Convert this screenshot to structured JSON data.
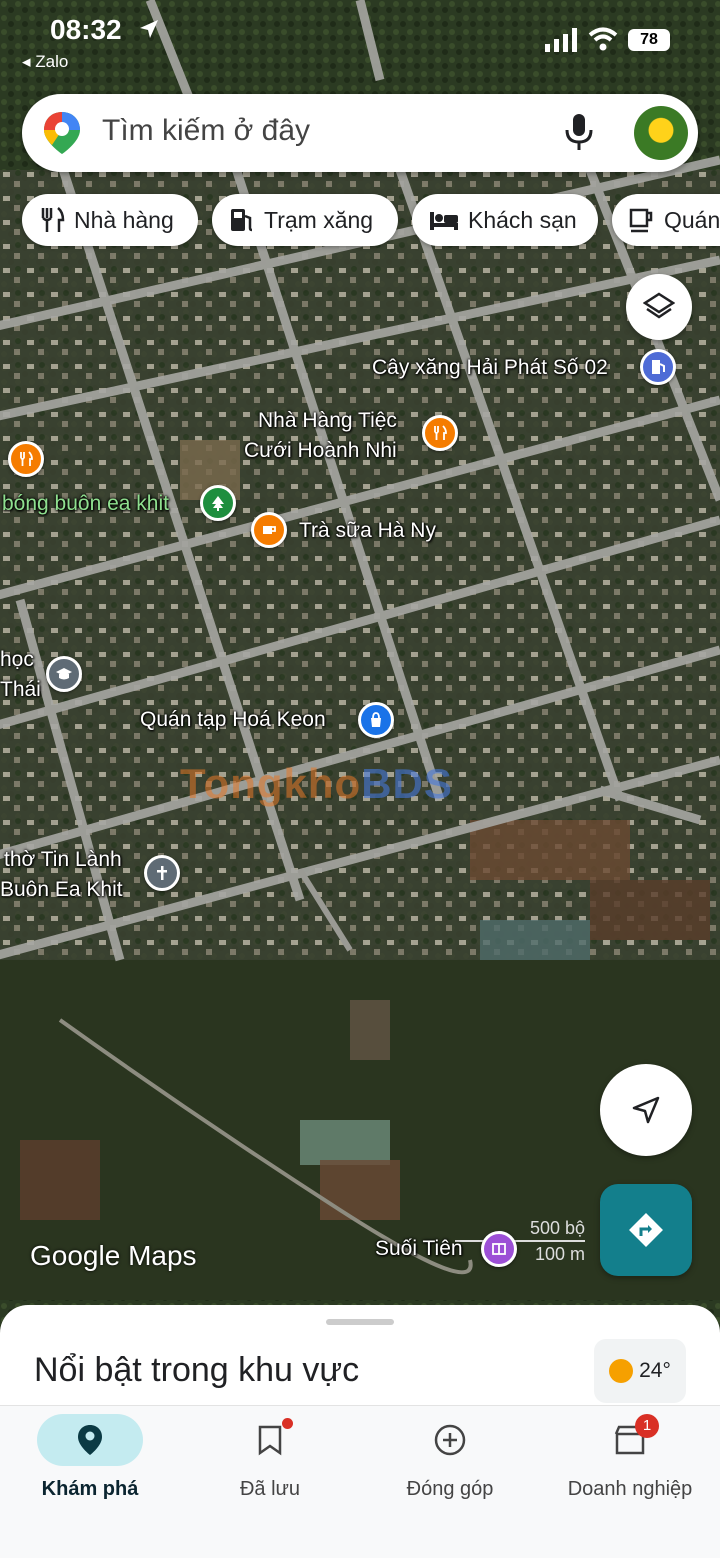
{
  "status_bar": {
    "time": "08:32",
    "back_app": "◂ Zalo",
    "battery": "78"
  },
  "search": {
    "placeholder": "Tìm kiếm ở đây"
  },
  "chips": [
    {
      "label": "Nhà hàng",
      "icon": "restaurant-icon"
    },
    {
      "label": "Trạm xăng",
      "icon": "gas-station-icon"
    },
    {
      "label": "Khách sạn",
      "icon": "hotel-icon"
    },
    {
      "label": "Quán",
      "icon": "cafe-icon"
    }
  ],
  "places": {
    "gas": "Cây xăng Hải Phát Số 02",
    "restaurant_line1": "Nhà Hàng Tiệc",
    "restaurant_line2": "Cưới Hoành Nhi",
    "park": "bóng buôn ea khit",
    "tea": "Trà sữa Hà Ny",
    "school_line1": "học",
    "school_line2": "Thái",
    "shop": "Quán tạp Hoá Keon",
    "church_line1": "thờ Tin Lành",
    "church_line2": "Buôn Ea Khit",
    "waterfall": "Suối Tiên"
  },
  "watermark": {
    "part1": "Tongkho",
    "part2": "BDS"
  },
  "map_brand": "Google Maps",
  "scale": {
    "imperial": "500 bộ",
    "metric": "100 m"
  },
  "sheet": {
    "title": "Nổi bật trong khu vực",
    "temperature": "24°"
  },
  "nav": [
    {
      "label": "Khám phá",
      "icon": "explore-pin-icon"
    },
    {
      "label": "Đã lưu",
      "icon": "bookmark-icon"
    },
    {
      "label": "Đóng góp",
      "icon": "add-circle-icon"
    },
    {
      "label": "Doanh nghiệp",
      "icon": "business-store-icon",
      "badge": "1"
    }
  ],
  "colors": {
    "accent": "#137f8c",
    "active_tab_bg": "#c4ebf0",
    "badge": "#d93025",
    "food_pin": "#f57c00",
    "park_pin": "#1e8e3e"
  }
}
